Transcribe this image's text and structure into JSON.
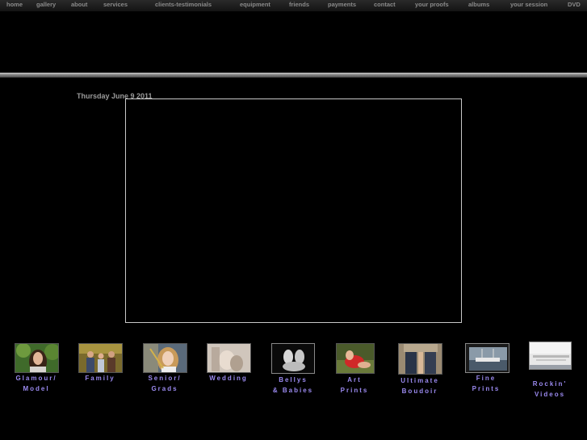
{
  "nav": {
    "home": "home",
    "gallery": "gallery",
    "about": "about",
    "services": "services",
    "clients": "clients-testimonials",
    "equipment": "equipment",
    "friends": "friends",
    "payments": "payments",
    "contact": "contact",
    "proofs": "your proofs",
    "albums": "albums",
    "session": "your session",
    "dvd": "DVD"
  },
  "page": {
    "date": "Thursday June 9 2011"
  },
  "categories": {
    "glamour": {
      "label": "Glamour/\nModel"
    },
    "family": {
      "label": "Family"
    },
    "senior": {
      "label": "Senior/\nGrads"
    },
    "wedding": {
      "label": "Wedding"
    },
    "bellys": {
      "label": "Bellys\n& Babies"
    },
    "art": {
      "label": "Art\nPrints"
    },
    "boudoir": {
      "label": "Ultimate\nBoudoir"
    },
    "fine": {
      "label": "Fine\nPrints"
    },
    "videos": {
      "label": "Rockin'\nVideos"
    }
  }
}
